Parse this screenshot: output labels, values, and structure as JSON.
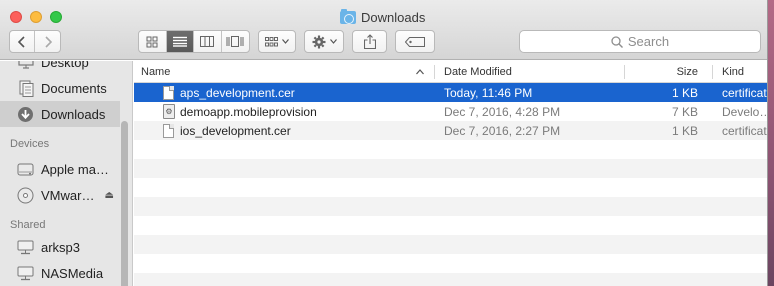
{
  "window": {
    "title": "Downloads"
  },
  "toolbar": {
    "search_placeholder": "Search"
  },
  "sidebar": {
    "items_top": [
      {
        "label": "Desktop",
        "icon": "desktop-icon"
      },
      {
        "label": "Documents",
        "icon": "documents-icon"
      },
      {
        "label": "Downloads",
        "icon": "downloads-icon",
        "selected": true
      }
    ],
    "devices_header": "Devices",
    "devices": [
      {
        "label": "Apple ma…",
        "icon": "disk-icon"
      },
      {
        "label": "VMwar…",
        "icon": "cd-icon",
        "eject": true
      }
    ],
    "shared_header": "Shared",
    "shared": [
      {
        "label": "arksp3",
        "icon": "network-computer-icon"
      },
      {
        "label": "NASMedia",
        "icon": "network-computer-icon"
      }
    ]
  },
  "columns": {
    "name": "Name",
    "date": "Date Modified",
    "size": "Size",
    "kind": "Kind"
  },
  "files": [
    {
      "name": "aps_development.cer",
      "date": "Today, 11:46 PM",
      "size": "1 KB",
      "kind": "certificat",
      "selected": true
    },
    {
      "name": "demoapp.mobileprovision",
      "date": "Dec 7, 2016, 4:28 PM",
      "size": "7 KB",
      "kind": "Develo…"
    },
    {
      "name": "ios_development.cer",
      "date": "Dec 7, 2016, 2:27 PM",
      "size": "1 KB",
      "kind": "certificat"
    }
  ],
  "colors": {
    "selection": "#1a64cf",
    "sidebar_bg": "#e6e6e6"
  }
}
